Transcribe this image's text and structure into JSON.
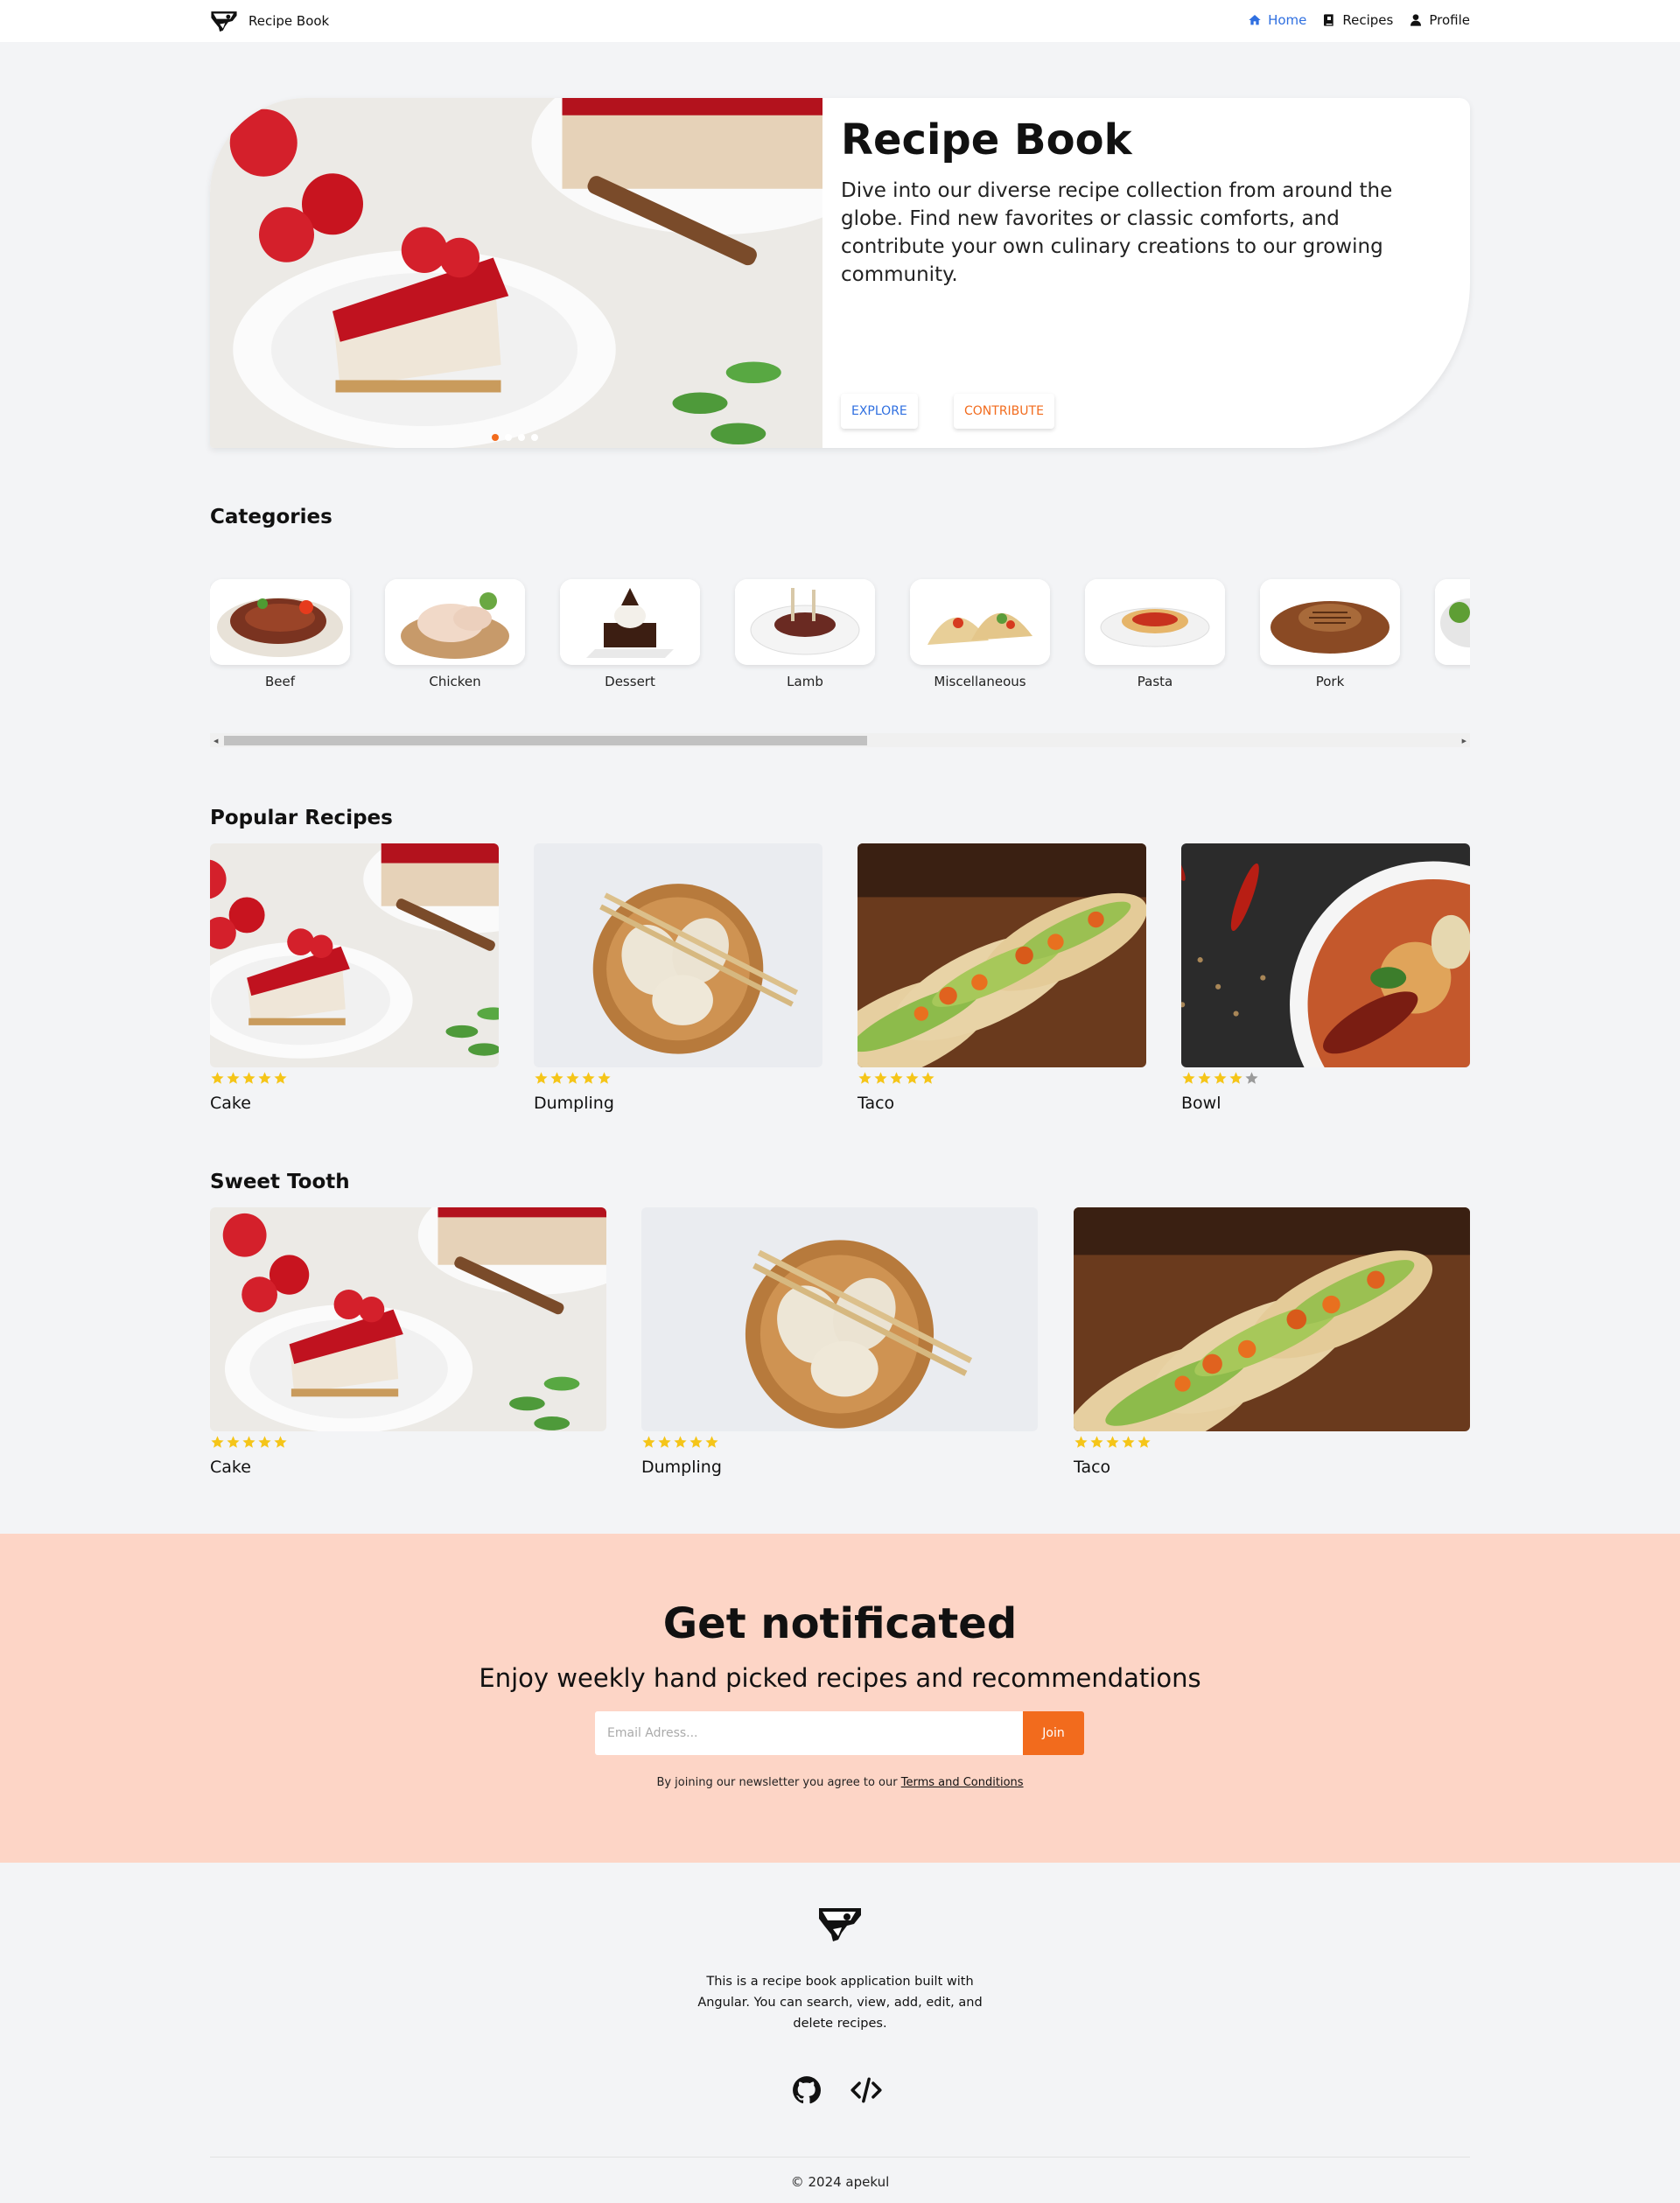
{
  "nav": {
    "brand": "Recipe Book",
    "links": [
      {
        "label": "Home",
        "icon": "home-icon",
        "active": true
      },
      {
        "label": "Recipes",
        "icon": "book-icon",
        "active": false
      },
      {
        "label": "Profile",
        "icon": "user-icon",
        "active": false
      }
    ]
  },
  "hero": {
    "title": "Recipe Book",
    "text": "Dive into our diverse recipe collection from around the globe. Find new favorites or classic comforts, and contribute your own culinary creations to our growing community.",
    "explore_label": "EXPLORE",
    "contribute_label": "CONTRIBUTE",
    "slide_count": 4,
    "active_slide": 1
  },
  "categories": {
    "title": "Categories",
    "items": [
      "Beef",
      "Chicken",
      "Dessert",
      "Lamb",
      "Miscellaneous",
      "Pasta",
      "Pork"
    ]
  },
  "popular": {
    "title": "Popular Recipes",
    "items": [
      {
        "name": "Cake",
        "rating": 5
      },
      {
        "name": "Dumpling",
        "rating": 5
      },
      {
        "name": "Taco",
        "rating": 5
      },
      {
        "name": "Bowl",
        "rating": 4
      }
    ]
  },
  "sweet": {
    "title": "Sweet Tooth",
    "items": [
      {
        "name": "Cake",
        "rating": 5
      },
      {
        "name": "Dumpling",
        "rating": 5
      },
      {
        "name": "Taco",
        "rating": 5
      }
    ]
  },
  "newsletter": {
    "title": "Get notificated",
    "subtitle": "Enjoy weekly hand picked recipes and recommendations",
    "placeholder": "Email Adress...",
    "join_label": "Join",
    "terms_prefix": "By joining our newsletter you agree to our",
    "terms_link": "Terms and Conditions"
  },
  "footer": {
    "description": "This is a recipe book application built with Angular. You can search, view, add, edit, and delete recipes.",
    "copyright": "© 2024 apekul"
  },
  "colors": {
    "accent_orange": "#f26b1d",
    "accent_blue": "#2f6fe0",
    "newsletter_bg": "#fdd5c6",
    "star": "#f5c518"
  }
}
